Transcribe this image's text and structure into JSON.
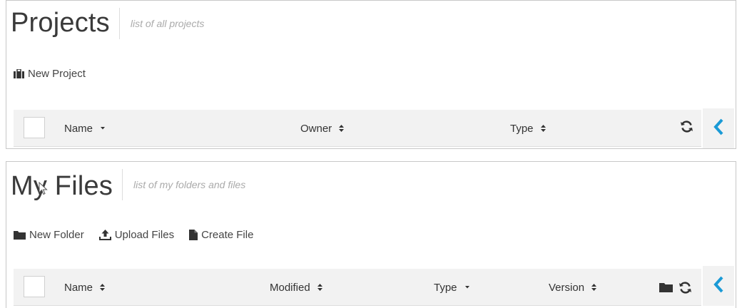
{
  "projects": {
    "title": "Projects",
    "subtitle": "list of all projects",
    "actions": [
      {
        "label": "New Project",
        "icon": "briefcase-icon"
      }
    ],
    "columns": [
      {
        "label": "Name",
        "sort": "sort-down-icon"
      },
      {
        "label": "Owner",
        "sort": "sort-both-icon"
      },
      {
        "label": "Type",
        "sort": "sort-both-icon"
      }
    ],
    "tools": [
      "refresh-icon"
    ],
    "collapse_icon": "chevron-left-icon"
  },
  "files": {
    "title": "My Files",
    "subtitle": "list of my folders and files",
    "actions": [
      {
        "label": "New Folder",
        "icon": "folder-icon"
      },
      {
        "label": "Upload Files",
        "icon": "upload-icon"
      },
      {
        "label": "Create File",
        "icon": "file-icon"
      }
    ],
    "columns": [
      {
        "label": "Name",
        "sort": "sort-both-icon"
      },
      {
        "label": "Modified",
        "sort": "sort-both-icon"
      },
      {
        "label": "Type",
        "sort": "sort-down-icon"
      },
      {
        "label": "Version",
        "sort": "sort-both-icon"
      }
    ],
    "tools": [
      "folder-icon",
      "refresh-icon"
    ],
    "collapse_icon": "chevron-left-icon"
  },
  "colors": {
    "accent": "#1a9ad6",
    "header_bg": "#f2f2f2",
    "title": "#3a3a3a",
    "subtitle": "#aaaaaa"
  }
}
